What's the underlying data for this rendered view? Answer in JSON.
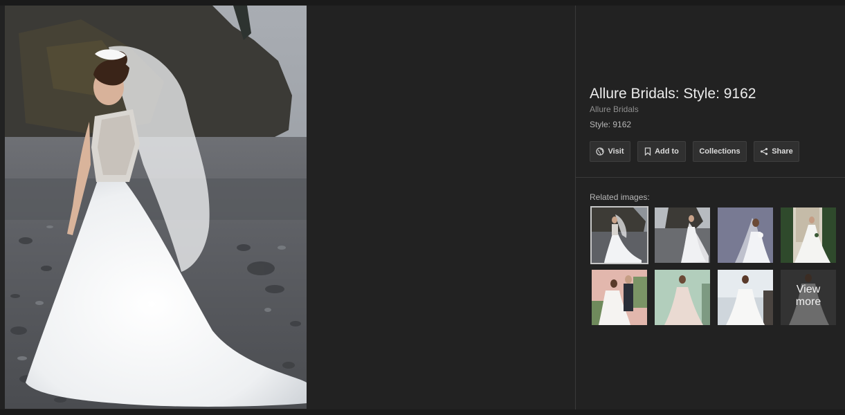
{
  "title": "Allure Bridals: Style: 9162",
  "source": "Allure Bridals",
  "description": "Style: 9162",
  "actions": {
    "visit": {
      "label": "Visit",
      "icon": "globe-icon"
    },
    "add_to": {
      "label": "Add to",
      "icon": "bookmark-icon"
    },
    "collections": {
      "label": "Collections"
    },
    "share": {
      "label": "Share",
      "icon": "share-icon"
    }
  },
  "related": {
    "label": "Related images:",
    "view_more": "View more"
  },
  "colors": {
    "background": "#222222",
    "button_bg": "#303030",
    "button_border": "#3f3f3f",
    "title_text": "#ececec",
    "muted_text": "#8f8f8f"
  }
}
